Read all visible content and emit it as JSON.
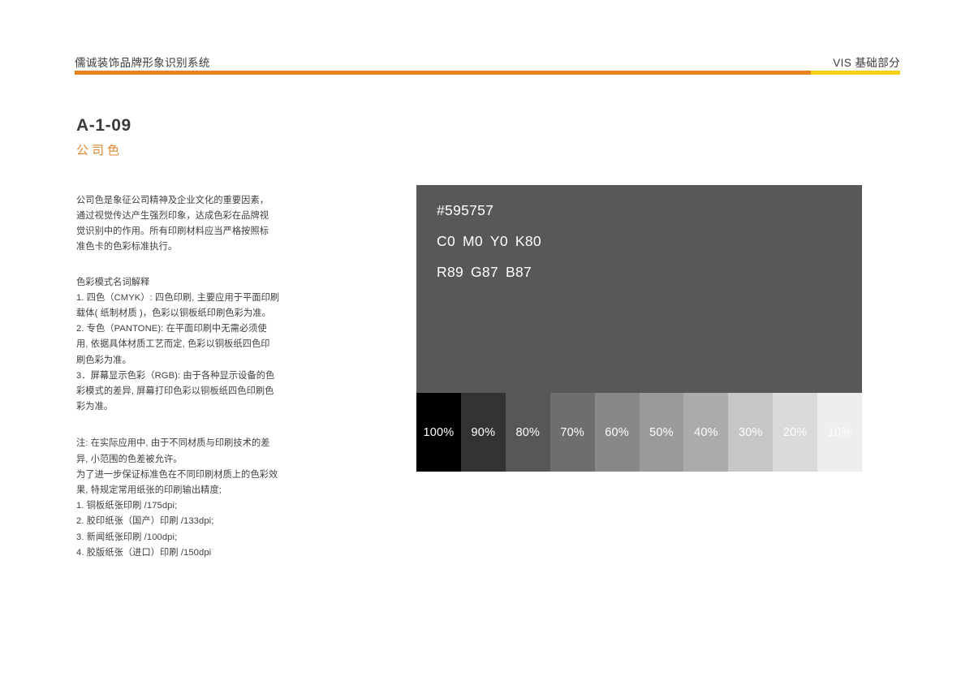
{
  "header": {
    "title": "儒诚装饰品牌形象识别系统",
    "section": "VIS 基础部分",
    "rule_color_left": "#e8821e",
    "rule_color_right": "#f7d117"
  },
  "left_column": {
    "doc_code": "A-1-09",
    "subtitle": "公司色",
    "subtitle_color": "#e08a2e",
    "intro": [
      "公司色是象征公司精神及企业文化的重要因素，",
      "通过视觉传达产生强烈印象，达成色彩在品牌视",
      "觉识别中的作用。所有印刷材料应当严格按照标",
      "准色卡的色彩标准执行。"
    ],
    "modes": [
      "色彩模式名词解释",
      "1. 四色（CMYK）: 四色印刷, 主要应用于平面印刷",
      "载体( 纸制材质 )，色彩以铜板纸印刷色彩为准。",
      "2. 专色（PANTONE): 在平面印刷中无需必须使",
      "用, 依据具体材质工艺而定, 色彩以铜板纸四色印",
      "刷色彩为准。",
      "3．屏幕显示色彩（RGB): 由于各种显示设备的色",
      "彩模式的差异, 屏幕打印色彩以铜板纸四色印刷色",
      "彩为准。"
    ],
    "note": [
      "注: 在实际应用中, 由于不同材质与印刷技术的差",
      "异, 小范围的色差被允许。",
      "为了进一步保证标准色在不同印刷材质上的色彩效",
      "果, 特规定常用纸张的印刷输出精度;"
    ],
    "dpi_list": [
      "1. 铜板纸张印刷 /175dpi;",
      "2. 胶印纸张（国产）印刷 /133dpi;",
      "3. 新闻纸张印刷 /100dpi;",
      "4. 胶版纸张（进口）印刷 /150dpi"
    ]
  },
  "color_panel": {
    "swatch_color": "#595757",
    "hex": "#595757",
    "cmyk": {
      "c": "C0",
      "m": "M0",
      "y": "Y0",
      "k": "K80"
    },
    "rgb": {
      "r": "R89",
      "g": "G87",
      "b": "B87"
    },
    "tints": [
      {
        "label": "100%",
        "color": "#000000"
      },
      {
        "label": "90%",
        "color": "#333333"
      },
      {
        "label": "80%",
        "color": "#575757"
      },
      {
        "label": "70%",
        "color": "#6e6e6e"
      },
      {
        "label": "60%",
        "color": "#888888"
      },
      {
        "label": "50%",
        "color": "#9a9a9a"
      },
      {
        "label": "40%",
        "color": "#ababab"
      },
      {
        "label": "30%",
        "color": "#c6c6c6"
      },
      {
        "label": "20%",
        "color": "#dadada"
      },
      {
        "label": "10%",
        "color": "#eeeeee"
      }
    ]
  }
}
